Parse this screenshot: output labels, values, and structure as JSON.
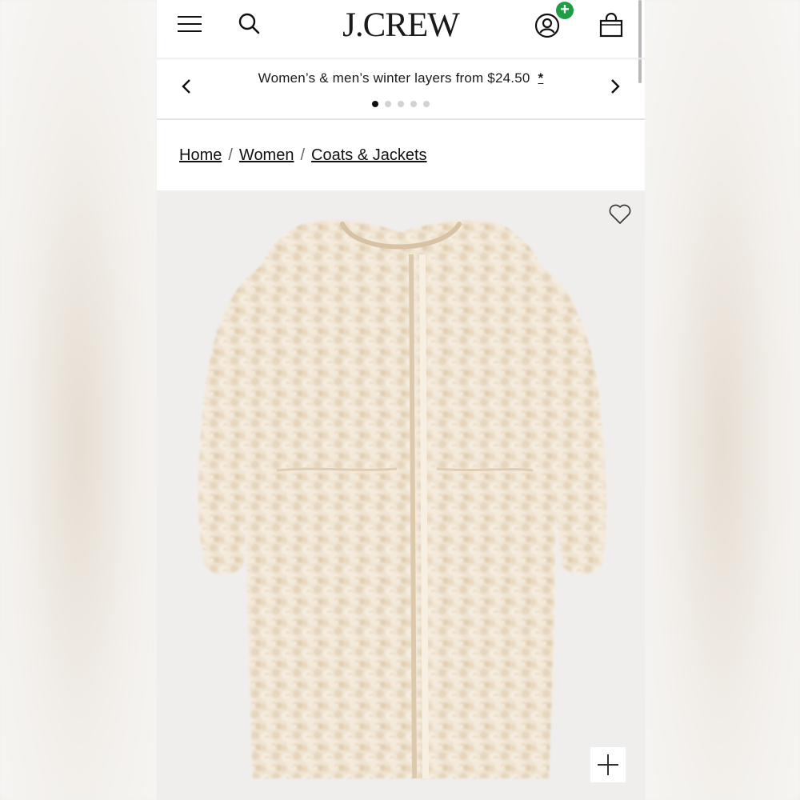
{
  "header": {
    "logo": "J.CREW",
    "menu_icon": "hamburger-menu-icon",
    "search_icon": "search-icon",
    "account_icon": "account-icon",
    "account_badge": "+",
    "bag_icon": "shopping-bag-icon",
    "badge_color": "#1f9d45"
  },
  "promo": {
    "text": "Women’s & men’s winter layers from $24.50",
    "details_link": "*",
    "slide_count": 5,
    "active_slide": 1
  },
  "breadcrumb": {
    "items": [
      "Home",
      "Women",
      "Coats & Jackets"
    ],
    "separator": "/"
  },
  "product": {
    "image_alt_icon": "teddy-coat-image",
    "wishlist_icon": "heart-icon",
    "zoom_icon": "plus-icon",
    "coat_color": "#efe3cf"
  }
}
